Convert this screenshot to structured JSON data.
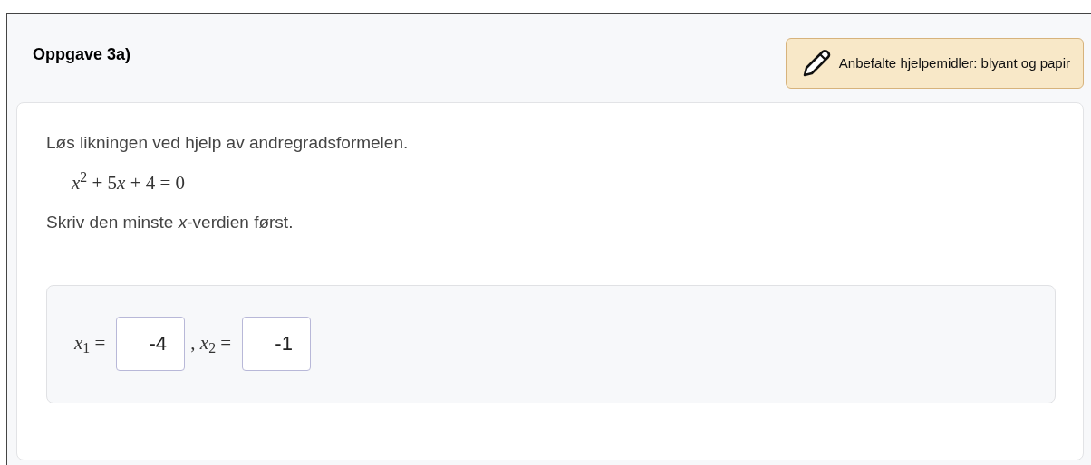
{
  "task": {
    "title": "Oppgave 3a)",
    "aid_note": "Anbefalte hjelpemidler: blyant og papir"
  },
  "question": {
    "prompt": "Løs likningen ved hjelp av andregradsformelen.",
    "equation_parts": [
      "*x*$^{2}$ + 5",
      "*x*",
      "+ 4 = 0"
    ],
    "instruction": "Skriv den minste *x*-verdien først."
  },
  "answers": [
    {
      "label": "*x*$_{1}$ =",
      "value": "-4"
    },
    {
      "label": ", *x*$_{2}$ =",
      "value": "-1"
    }
  ]
}
